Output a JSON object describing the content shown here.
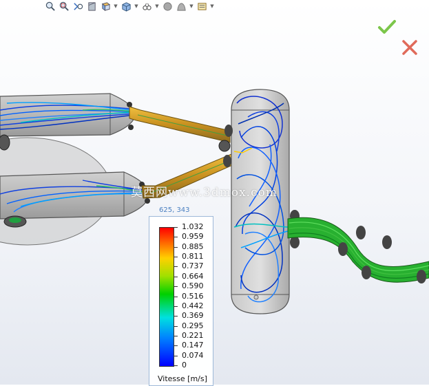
{
  "toolbar": {
    "tools": [
      "zoom-to-fit-icon",
      "zoom-to-area-icon",
      "previous-view-icon",
      "section-view-icon",
      "view-orientation-icon",
      "display-style-icon",
      "hide-show-items-icon",
      "edit-appearance-icon",
      "apply-scene-icon",
      "view-settings-icon"
    ]
  },
  "confirm": {
    "icon": "checkmark-icon",
    "color": "#6abf3a"
  },
  "cancel": {
    "icon": "close-icon",
    "color": "#e05a4a"
  },
  "watermark": "莫西网www.3dmox.com",
  "probe": {
    "coordinates": "625, 343"
  },
  "legend": {
    "title": "Vitesse [m/s]",
    "labels": [
      "1.032",
      "0.959",
      "0.885",
      "0.811",
      "0.737",
      "0.664",
      "0.590",
      "0.516",
      "0.442",
      "0.369",
      "0.295",
      "0.221",
      "0.147",
      "0.074",
      "0"
    ],
    "max": 1.032,
    "min": 0
  },
  "colors": {
    "low": "#0000ff",
    "mid": "#00d000",
    "high": "#ff0000",
    "pipe": "#d8a020"
  }
}
